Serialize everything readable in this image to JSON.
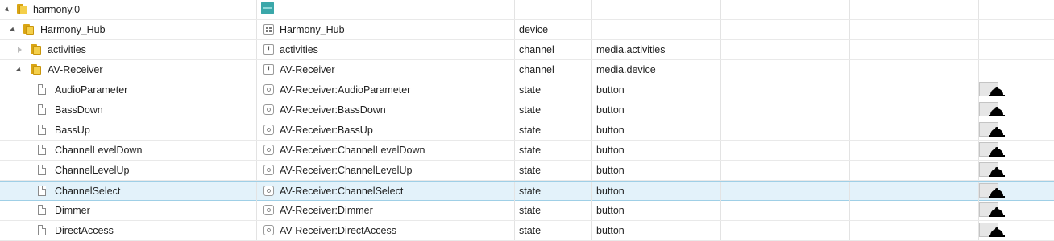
{
  "root": {
    "name": "harmony.0"
  },
  "hub": {
    "name": "Harmony_Hub",
    "title": "Harmony_Hub",
    "type": "device"
  },
  "activities": {
    "name": "activities",
    "title": "activities",
    "type": "channel",
    "role": "media.activities"
  },
  "receiver": {
    "name": "AV-Receiver",
    "title": "AV-Receiver",
    "type": "channel",
    "role": "media.device"
  },
  "states": [
    {
      "name": "AudioParameter",
      "title": "AV-Receiver:AudioParameter",
      "type": "state",
      "role": "button",
      "selected": false
    },
    {
      "name": "BassDown",
      "title": "AV-Receiver:BassDown",
      "type": "state",
      "role": "button",
      "selected": false
    },
    {
      "name": "BassUp",
      "title": "AV-Receiver:BassUp",
      "type": "state",
      "role": "button",
      "selected": false
    },
    {
      "name": "ChannelLevelDown",
      "title": "AV-Receiver:ChannelLevelDown",
      "type": "state",
      "role": "button",
      "selected": false
    },
    {
      "name": "ChannelLevelUp",
      "title": "AV-Receiver:ChannelLevelUp",
      "type": "state",
      "role": "button",
      "selected": false
    },
    {
      "name": "ChannelSelect",
      "title": "AV-Receiver:ChannelSelect",
      "type": "state",
      "role": "button",
      "selected": true
    },
    {
      "name": "Dimmer",
      "title": "AV-Receiver:Dimmer",
      "type": "state",
      "role": "button",
      "selected": false
    },
    {
      "name": "DirectAccess",
      "title": "AV-Receiver:DirectAccess",
      "type": "state",
      "role": "button",
      "selected": false
    }
  ],
  "colors": {
    "selected_row": "#e3f2fa",
    "folder": "#f4cf4a",
    "adapter_icon": "#3aa7a9"
  }
}
